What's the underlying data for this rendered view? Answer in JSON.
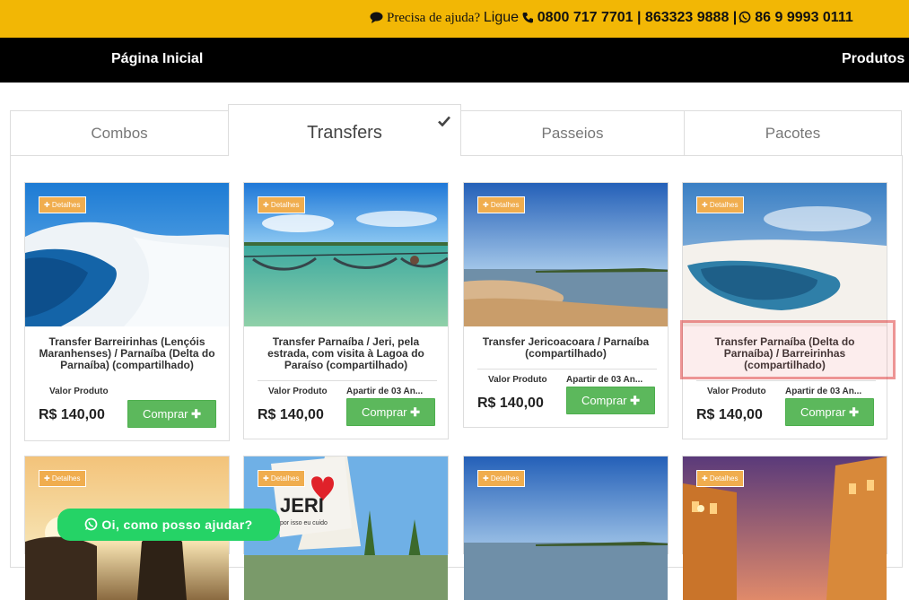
{
  "topbar": {
    "help_text": "Precisa de ajuda?",
    "ligue_text": "Ligue",
    "phones": "0800 717 7701 | 863323 9888 |",
    "whatsapp": "86 9 9993 0111"
  },
  "nav": {
    "home": "Página Inicial",
    "products": "Produtos"
  },
  "tabs": [
    {
      "label": "Combos"
    },
    {
      "label": "Transfers"
    },
    {
      "label": "Passeios"
    },
    {
      "label": "Pacotes"
    }
  ],
  "cards": [
    {
      "details": "✚ Detalhes",
      "title": "Transfer Barreirinhas (Lençóis Maranhenses) / Parnaíba (Delta do Parnaíba) (compartilhado)",
      "valor_label": "Valor Produto",
      "price": "R$ 140,00",
      "buy": "Comprar"
    },
    {
      "details": "✚ Detalhes",
      "title": "Transfer Parnaíba / Jeri, pela estrada, com visita à Lagoa do Paraíso (compartilhado)",
      "valor_label": "Valor Produto",
      "apartir": "Apartir de 03 An...",
      "price": "R$ 140,00",
      "buy": "Comprar"
    },
    {
      "details": "✚ Detalhes",
      "title": "Transfer Jericoacoara / Parnaíba (compartilhado)",
      "valor_label": "Valor Produto",
      "apartir": "Apartir de 03 An...",
      "price": "R$ 140,00",
      "buy": "Comprar"
    },
    {
      "details": "✚ Detalhes",
      "title": "Transfer Parnaíba (Delta do Parnaíba) / Barreirinhas (compartilhado)",
      "valor_label": "Valor Produto",
      "apartir": "Apartir de 03 An...",
      "price": "R$ 140,00",
      "buy": "Comprar"
    }
  ],
  "cards_row2": [
    {
      "details": "✚ Detalhes"
    },
    {
      "details": "✚ Detalhes",
      "sign_text": "JERI",
      "sign_small": "por isso eu cuido"
    },
    {
      "details": "✚ Detalhes"
    },
    {
      "details": "✚ Detalhes"
    }
  ],
  "chat": {
    "label": "Oi, como posso ajudar?"
  },
  "colors": {
    "topbar": "#f2b705",
    "navbar": "#000000",
    "buy": "#5cb85c",
    "details": "#f0ad4e",
    "chat": "#25d366"
  }
}
